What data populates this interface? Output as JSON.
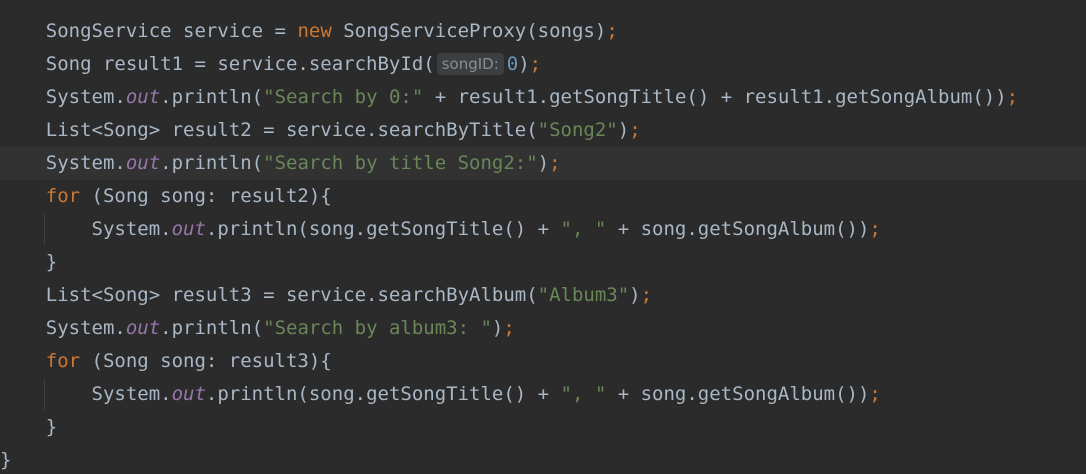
{
  "code": {
    "l1": {
      "indent": "    ",
      "t1": "SongService service = ",
      "kw": "new",
      "t2": " SongServiceProxy(songs)",
      "semi": ";"
    },
    "l2": {
      "indent": "    ",
      "t1": "Song result1 = service.searchById(",
      "hint": "songID:",
      "num": "0",
      "t2": ")",
      "semi": ";"
    },
    "l3": {
      "indent": "    ",
      "t1": "System.",
      "field": "out",
      "t2": ".println(",
      "str": "\"Search by 0:\"",
      "t3": " + result1.getSongTitle() + result1.getSongAlbum())",
      "semi": ";"
    },
    "l4": {
      "indent": "    ",
      "t1": "List<Song> result2 = service.searchByTitle(",
      "str": "\"Song2\"",
      "t2": ")",
      "semi": ";"
    },
    "l5": {
      "indent": "    ",
      "t1": "System.",
      "field": "out",
      "t2": ".println(",
      "str": "\"Search by title Song2:\"",
      "t3": ")",
      "semi": ";"
    },
    "l6": {
      "indent": "    ",
      "kw": "for",
      "t1": " (Song song: result2){"
    },
    "l7": {
      "indent": "        ",
      "t1": "System.",
      "field": "out",
      "t2": ".println(song.getSongTitle() + ",
      "str": "\", \"",
      "t3": " + song.getSongAlbum())",
      "semi": ";"
    },
    "l8": {
      "indent": "    ",
      "t1": "}"
    },
    "l9": {
      "indent": "    ",
      "t1": "List<Song> result3 = service.searchByAlbum(",
      "str": "\"Album3\"",
      "t2": ")",
      "semi": ";"
    },
    "l10": {
      "indent": "    ",
      "t1": "System.",
      "field": "out",
      "t2": ".println(",
      "str": "\"Search by album3: \"",
      "t3": ")",
      "semi": ";"
    },
    "l11": {
      "indent": "    ",
      "kw": "for",
      "t1": " (Song song: result3){"
    },
    "l12": {
      "indent": "        ",
      "t1": "System.",
      "field": "out",
      "t2": ".println(song.getSongTitle() + ",
      "str": "\", \"",
      "t3": " + song.getSongAlbum())",
      "semi": ";"
    },
    "l13": {
      "indent": "    ",
      "t1": "}"
    },
    "l14": {
      "indent": "",
      "t1": "}"
    }
  },
  "colors": {
    "background": "#2b2b2b",
    "current_line": "#323232",
    "default_text": "#a9b7c6",
    "keyword": "#cc7832",
    "string": "#6a8759",
    "number": "#6897bb",
    "static_field": "#9876aa",
    "inlay_hint_bg": "#3b3f41",
    "inlay_hint_text": "#8c8c8c"
  }
}
